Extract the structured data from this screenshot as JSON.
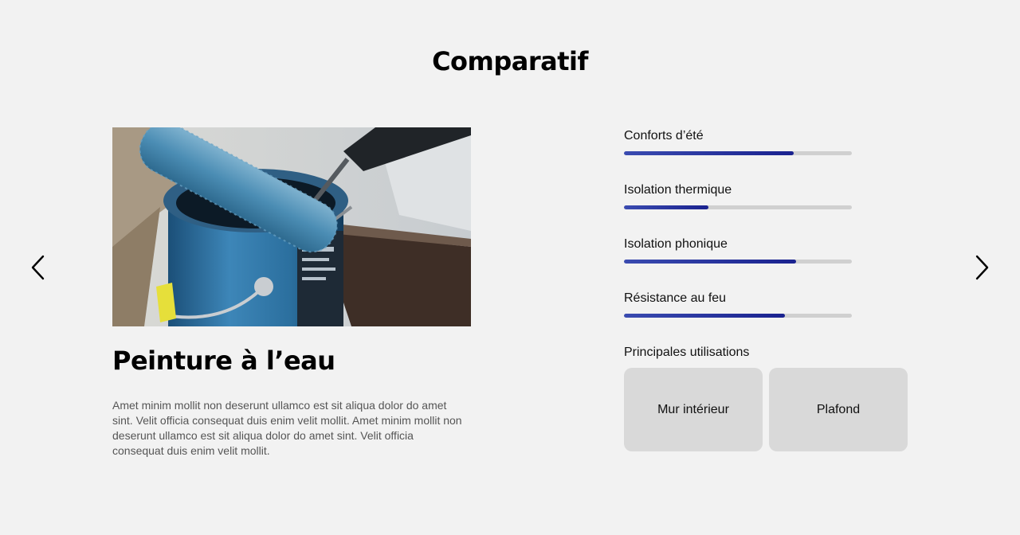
{
  "section_title": "Comparatif",
  "navigation": {
    "prev_icon": "chevron-left-icon",
    "next_icon": "chevron-right-icon"
  },
  "product": {
    "name": "Peinture à l’eau",
    "description": "Amet minim mollit non deserunt ullamco est sit aliqua dolor do amet sint. Velit officia consequat duis enim velit mollit. Amet minim mollit non deserunt ullamco est sit aliqua dolor do amet sint. Velit officia consequat duis enim velit mollit.",
    "image_subject": "blue paint roller resting on an open paint can"
  },
  "ratings": [
    {
      "label": "Conforts d’été",
      "level": 0.745
    },
    {
      "label": "Isolation thermique",
      "level": 0.37
    },
    {
      "label": "Isolation phonique",
      "level": 0.755
    },
    {
      "label": "Résistance au feu",
      "level": 0.705
    }
  ],
  "usage": {
    "heading": "Principales utilisations",
    "items": [
      "Mur intérieur",
      "Plafond"
    ]
  },
  "colors": {
    "background": "#f2f2f2",
    "bar_fill": "#1a228f",
    "bar_track": "#d0d0d0",
    "card_background": "#d9d9d9"
  }
}
